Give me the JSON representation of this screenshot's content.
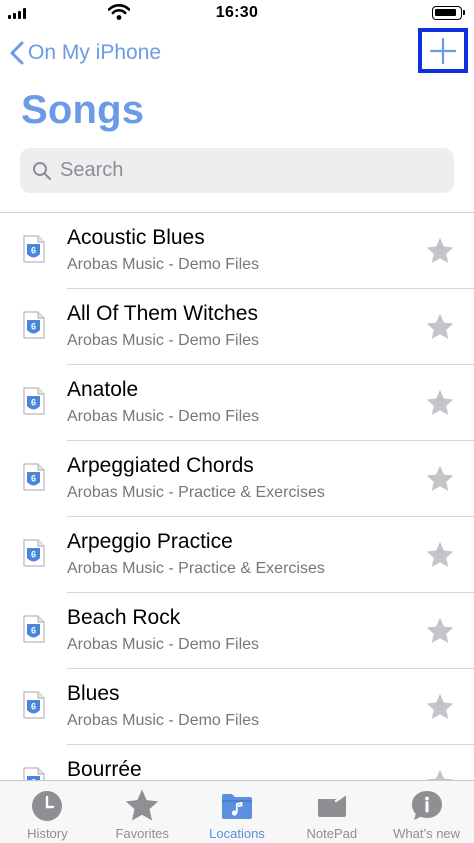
{
  "status_bar": {
    "time": "16:30"
  },
  "nav": {
    "back_label": "On My iPhone",
    "add_button_icon": "plus-icon"
  },
  "title": "Songs",
  "search": {
    "placeholder": "Search",
    "value": ""
  },
  "songs": [
    {
      "title": "Acoustic Blues",
      "subtitle": "Arobas Music - Demo Files"
    },
    {
      "title": "All Of Them Witches",
      "subtitle": "Arobas Music - Demo Files"
    },
    {
      "title": "Anatole",
      "subtitle": "Arobas Music - Demo Files"
    },
    {
      "title": "Arpeggiated Chords",
      "subtitle": "Arobas Music - Practice & Exercises"
    },
    {
      "title": "Arpeggio Practice",
      "subtitle": "Arobas Music - Practice & Exercises"
    },
    {
      "title": "Beach Rock",
      "subtitle": "Arobas Music - Demo Files"
    },
    {
      "title": "Blues",
      "subtitle": "Arobas Music - Demo Files"
    },
    {
      "title": "Bourrée",
      "subtitle": ""
    }
  ],
  "tabs": [
    {
      "label": "History",
      "icon": "clock-icon",
      "active": false
    },
    {
      "label": "Favorites",
      "icon": "star-icon",
      "active": false
    },
    {
      "label": "Locations",
      "icon": "folder-music-icon",
      "active": true
    },
    {
      "label": "NotePad",
      "icon": "notepad-icon",
      "active": false
    },
    {
      "label": "What’s new",
      "icon": "info-icon",
      "active": false
    }
  ],
  "colors": {
    "accent": "#6b9be6",
    "highlight_box": "#0f2fe0",
    "star": "#c4c4c8",
    "inactive_tab": "#8e8e93"
  }
}
